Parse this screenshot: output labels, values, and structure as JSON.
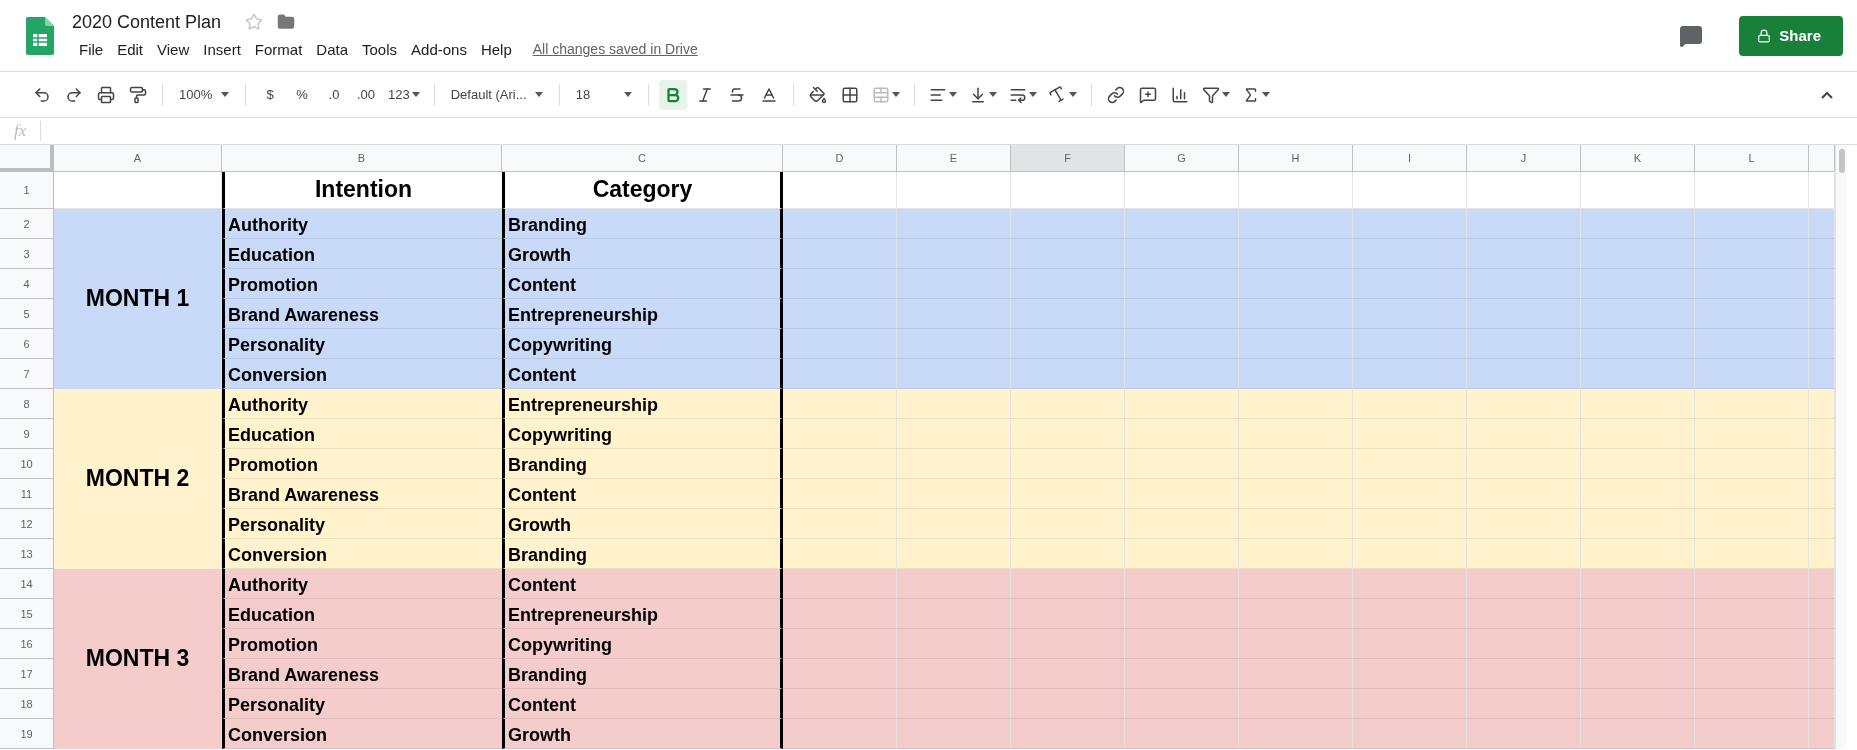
{
  "doc": {
    "title": "2020 Content Plan",
    "menus": [
      "File",
      "Edit",
      "View",
      "Insert",
      "Format",
      "Data",
      "Tools",
      "Add-ons",
      "Help"
    ],
    "save_status": "All changes saved in Drive",
    "share_label": "Share"
  },
  "toolbar": {
    "zoom": "100%",
    "currency": "$",
    "percent": "%",
    "decimal_less": ".0",
    "decimal_more": ".00",
    "number_format": "123",
    "font": "Default (Ari...",
    "font_size": "18",
    "bold_on": true
  },
  "formula_bar": {
    "label": "fx"
  },
  "sheet": {
    "columns": [
      {
        "label": "A",
        "selected": false
      },
      {
        "label": "B",
        "selected": false
      },
      {
        "label": "C",
        "selected": false
      },
      {
        "label": "D",
        "selected": false
      },
      {
        "label": "E",
        "selected": false
      },
      {
        "label": "F",
        "selected": true
      },
      {
        "label": "G",
        "selected": false
      },
      {
        "label": "H",
        "selected": false
      },
      {
        "label": "I",
        "selected": false
      },
      {
        "label": "J",
        "selected": false
      },
      {
        "label": "K",
        "selected": false
      },
      {
        "label": "L",
        "selected": false
      }
    ],
    "row_numbers": [
      "1",
      "2",
      "3",
      "4",
      "5",
      "6",
      "7",
      "8",
      "9",
      "10",
      "11",
      "12",
      "13",
      "14",
      "15",
      "16",
      "17",
      "18",
      "19"
    ],
    "headers": [
      "Intention",
      "Category"
    ],
    "groups": [
      {
        "label": "MONTH 1",
        "color": "#c9daf8",
        "rows": [
          {
            "intention": "Authority",
            "category": "Branding"
          },
          {
            "intention": "Education",
            "category": "Growth"
          },
          {
            "intention": "Promotion",
            "category": "Content"
          },
          {
            "intention": "Brand Awareness",
            "category": "Entrepreneurship"
          },
          {
            "intention": "Personality",
            "category": "Copywriting"
          },
          {
            "intention": "Conversion",
            "category": "Content"
          }
        ]
      },
      {
        "label": "MONTH 2",
        "color": "#fff2cc",
        "rows": [
          {
            "intention": "Authority",
            "category": "Entrepreneurship"
          },
          {
            "intention": "Education",
            "category": "Copywriting"
          },
          {
            "intention": "Promotion",
            "category": "Branding"
          },
          {
            "intention": "Brand Awareness",
            "category": "Content"
          },
          {
            "intention": "Personality",
            "category": "Growth"
          },
          {
            "intention": "Conversion",
            "category": "Branding"
          }
        ]
      },
      {
        "label": "MONTH 3",
        "color": "#f4cccc",
        "rows": [
          {
            "intention": "Authority",
            "category": "Content"
          },
          {
            "intention": "Education",
            "category": "Entrepreneurship"
          },
          {
            "intention": "Promotion",
            "category": "Copywriting"
          },
          {
            "intention": "Brand Awareness",
            "category": "Branding"
          },
          {
            "intention": "Personality",
            "category": "Content"
          },
          {
            "intention": "Conversion",
            "category": "Growth"
          }
        ]
      }
    ]
  }
}
